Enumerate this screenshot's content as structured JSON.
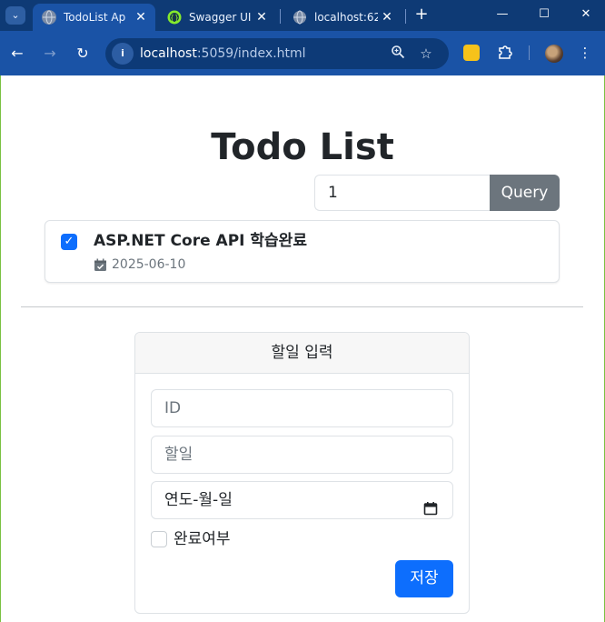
{
  "browser": {
    "tabs": [
      {
        "title": "TodoList App",
        "favicon": "globe-icon",
        "active": true
      },
      {
        "title": "Swagger UI",
        "favicon": "swagger-icon",
        "active": false
      },
      {
        "title": "localhost:62",
        "favicon": "globe-icon",
        "active": false
      }
    ],
    "tab_close_glyph": "✕",
    "new_tab_glyph": "+",
    "window_controls": {
      "minimize": "—",
      "maximize": "☐",
      "close": "✕"
    },
    "address": {
      "host": "localhost",
      "path": ":5059/index.html"
    },
    "colors": {
      "titlebar": "#0e3a75",
      "toolbar": "#1a53a6",
      "omnibox": "#0d3a77"
    }
  },
  "page": {
    "title": "Todo List",
    "query": {
      "value": "1",
      "button_label": "Query"
    },
    "todos": [
      {
        "title": "ASP.NET Core API 학습완료",
        "date": "2025-06-10",
        "completed": true
      }
    ],
    "form": {
      "header": "할일 입력",
      "id_placeholder": "ID",
      "todo_placeholder": "할일",
      "date_placeholder": "연도-월-일",
      "done_label": "완료여부",
      "done_checked": false,
      "save_label": "저장"
    },
    "colors": {
      "primary": "#0d6efd",
      "secondary": "#6c757d",
      "text": "#212529"
    }
  }
}
